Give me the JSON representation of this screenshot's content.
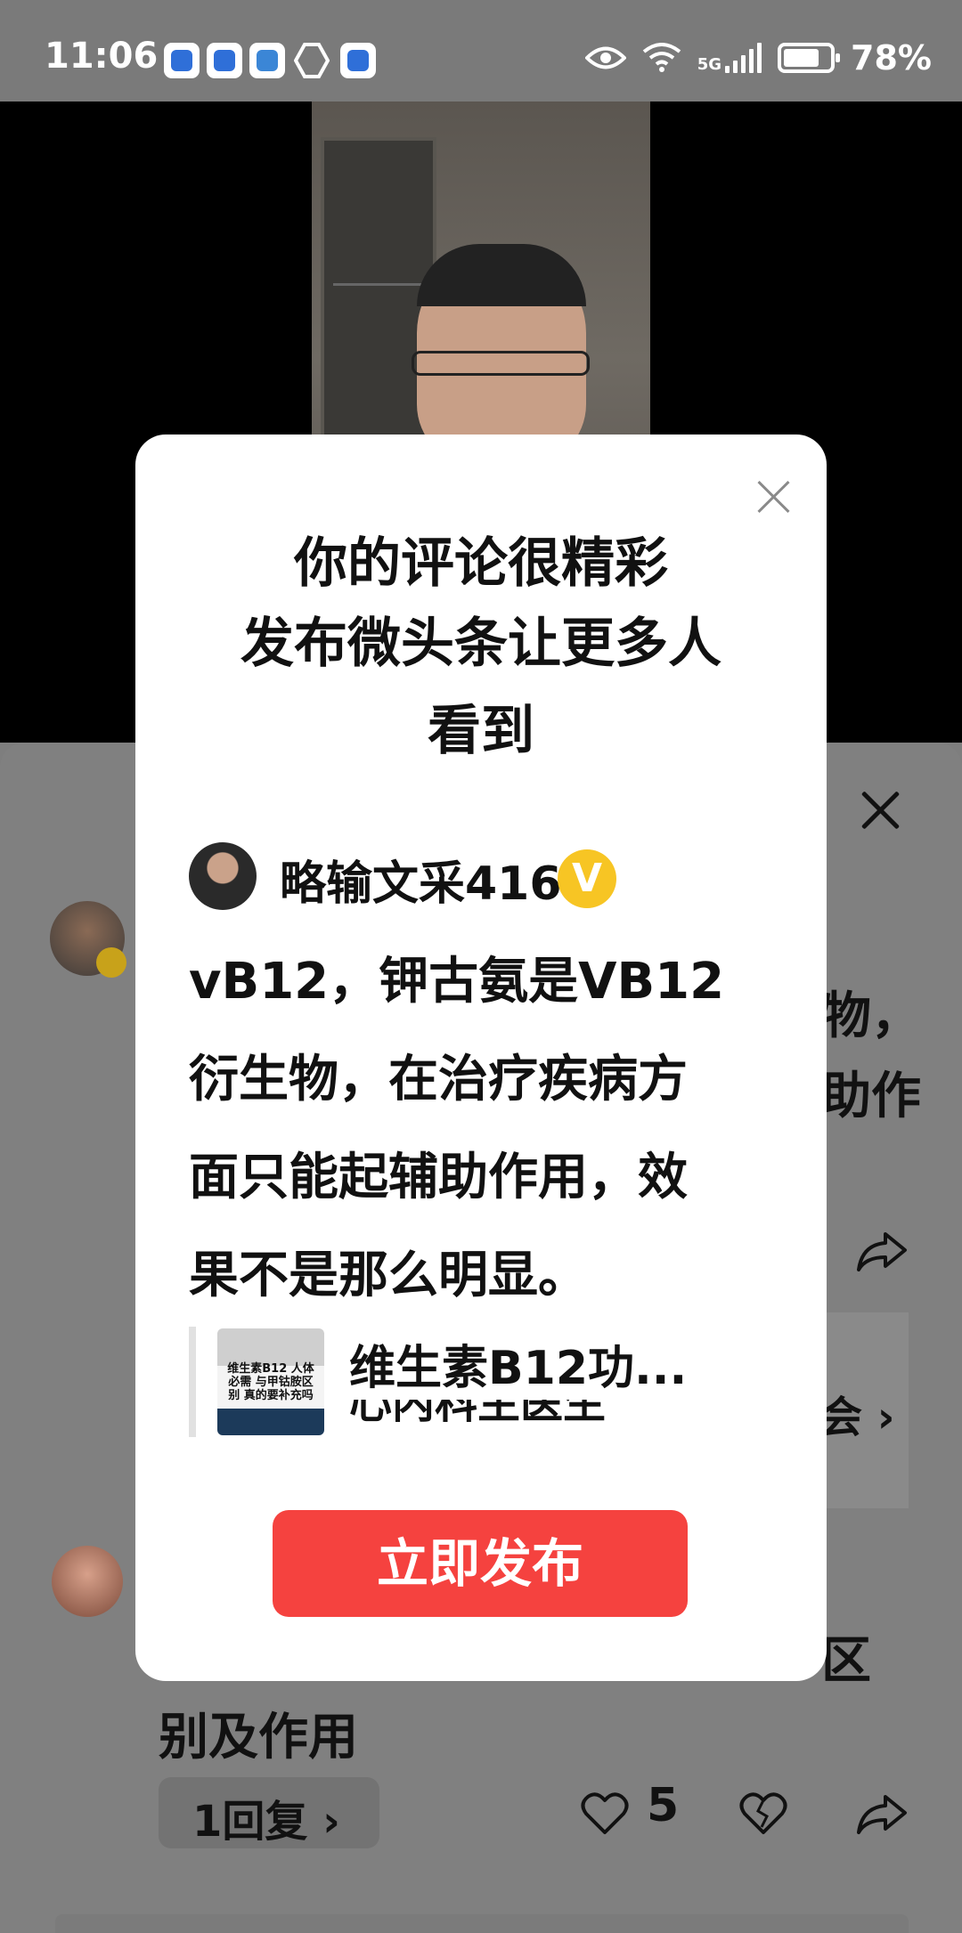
{
  "status_bar": {
    "time": "11:06",
    "network": "5G",
    "battery_percent": "78%",
    "battery_level": 0.78
  },
  "background_comments": {
    "comment1_right_lines": [
      "物，",
      "助作"
    ],
    "card_arrow": "会 ›",
    "comment2_partial_line": "区",
    "comment2_last_line": "别及作用",
    "reply_label": "1回复 ›",
    "like_count": "5"
  },
  "dialog": {
    "title_lines": [
      "你的评论很精彩",
      "发布微头条让更多人",
      "看到"
    ],
    "author_name": "略输文采416",
    "verified_badge": "V",
    "comment_lines": [
      "vB12，钾古氨是VB12",
      "衍生物，在治疗疾病方",
      "面只能起辅助作用，效",
      "果不是那么明显。"
    ],
    "thumbnail_text": "维生素B12 人体必需 与甲钴胺区别 真的要补充吗",
    "link_title": "维生素B12功...",
    "link_subtitle": "心内科主医生",
    "publish_label": "立即发布"
  },
  "colors": {
    "accent_red": "#f5423f",
    "badge_yellow": "#f7c524",
    "overlay_gray": "#808080"
  },
  "icons": [
    "close-icon",
    "share-icon",
    "heart-icon",
    "broken-heart-icon",
    "eye-icon",
    "wifi-icon",
    "signal-icon",
    "battery-icon",
    "verified-badge-icon"
  ]
}
